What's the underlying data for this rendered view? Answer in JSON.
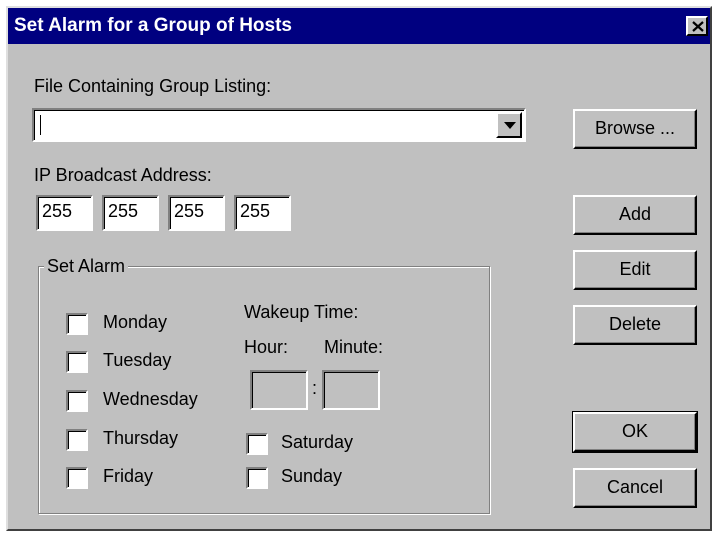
{
  "window": {
    "title": "Set Alarm for a Group of Hosts"
  },
  "file": {
    "label": "File Containing Group Listing:",
    "value": ""
  },
  "ip": {
    "label": "IP Broadcast Address:",
    "octets": [
      "255",
      "255",
      "255",
      "255"
    ]
  },
  "group": {
    "title": "Set Alarm",
    "days_left": [
      "Monday",
      "Tuesday",
      "Wednesday",
      "Thursday",
      "Friday"
    ],
    "days_right": [
      "Saturday",
      "Sunday"
    ],
    "wakeup_label": "Wakeup Time:",
    "hour_label": "Hour:",
    "minute_label": "Minute:",
    "time_separator": ":",
    "hour_value": "",
    "minute_value": ""
  },
  "buttons": {
    "browse": "Browse ...",
    "add": "Add",
    "edit": "Edit",
    "delete": "Delete",
    "ok": "OK",
    "cancel": "Cancel"
  },
  "colors": {
    "titlebar": "#000080",
    "face": "#c0c0c0"
  },
  "icons": {
    "close": "close-icon",
    "dropdown": "chevron-down-icon"
  }
}
